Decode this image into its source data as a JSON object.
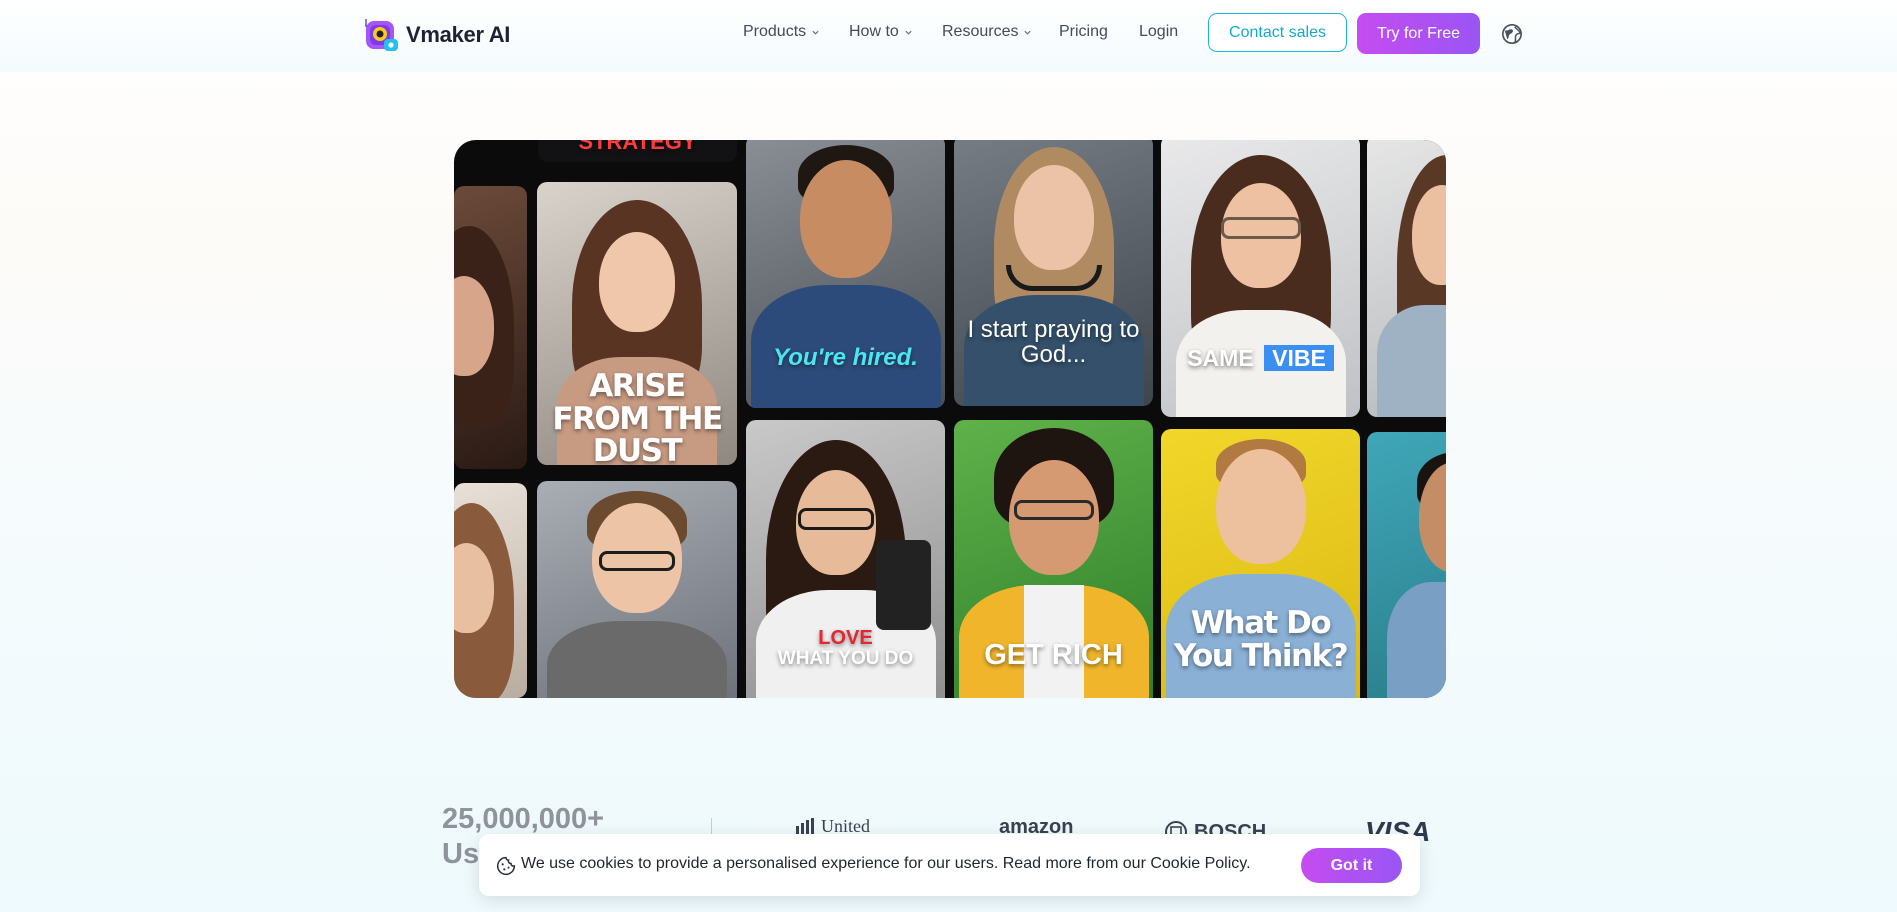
{
  "header": {
    "brand_name": "Vmaker AI",
    "nav": [
      {
        "label": "Products",
        "has_dropdown": true
      },
      {
        "label": "How to",
        "has_dropdown": true
      },
      {
        "label": "Resources",
        "has_dropdown": true
      },
      {
        "label": "Pricing",
        "has_dropdown": false
      },
      {
        "label": "Login",
        "has_dropdown": false
      }
    ],
    "contact_sales_label": "Contact sales",
    "try_free_label": "Try for Free",
    "language_icon": "globe-icon"
  },
  "hero": {
    "tiles": [
      {
        "caption": "ARISE FROM THE DUST"
      },
      {
        "caption": "You're hired."
      },
      {
        "caption": "I start praying to God..."
      },
      {
        "caption_plain": "SAME",
        "caption_highlight": "VIBE"
      },
      {
        "caption_top": "LOVE",
        "caption_bottom": "WHAT YOU DO"
      },
      {
        "caption": "GET RICH"
      },
      {
        "caption": "What Do You Think?"
      }
    ]
  },
  "stats": {
    "users_number": "25,000,000+",
    "users_label": "Us"
  },
  "brands": [
    "United",
    "amazon",
    "BOSCH",
    "VISA"
  ],
  "cookie_banner": {
    "text": "We use cookies to provide a personalised experience for our users. Read more from our Cookie Policy.",
    "button_label": "Got it",
    "icon": "cookie-icon"
  },
  "colors": {
    "accent_cyan": "#1fb6d8",
    "accent_purple_start": "#c54cf0",
    "accent_purple_end": "#9a55f5"
  }
}
